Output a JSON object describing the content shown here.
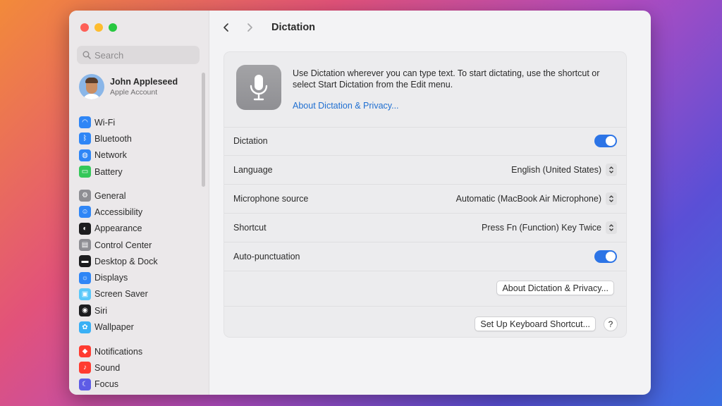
{
  "window": {
    "colors": {
      "accent": "#2c74e6",
      "link": "#1f6fd1",
      "sidebar": "#ebe8ea",
      "content": "#f3f3f5"
    }
  },
  "search": {
    "placeholder": "Search"
  },
  "account": {
    "name": "John Appleseed",
    "subtitle": "Apple Account"
  },
  "sidebar": {
    "groups": [
      [
        {
          "label": "Wi-Fi",
          "icon": "wifi-icon",
          "color": "#2f86f6"
        },
        {
          "label": "Bluetooth",
          "icon": "bluetooth-icon",
          "color": "#2f86f6"
        },
        {
          "label": "Network",
          "icon": "globe-icon",
          "color": "#2f86f6"
        },
        {
          "label": "Battery",
          "icon": "battery-icon",
          "color": "#34c759"
        }
      ],
      [
        {
          "label": "General",
          "icon": "gear-icon",
          "color": "#8e8e93"
        },
        {
          "label": "Accessibility",
          "icon": "accessibility-icon",
          "color": "#2f86f6"
        },
        {
          "label": "Appearance",
          "icon": "appearance-icon",
          "color": "#1c1c1e"
        },
        {
          "label": "Control Center",
          "icon": "control-center-icon",
          "color": "#8e8e93"
        },
        {
          "label": "Desktop & Dock",
          "icon": "dock-icon",
          "color": "#1c1c1e"
        },
        {
          "label": "Displays",
          "icon": "sun-icon",
          "color": "#2f86f6"
        },
        {
          "label": "Screen Saver",
          "icon": "screen-saver-icon",
          "color": "#5ac8fa"
        },
        {
          "label": "Siri",
          "icon": "siri-icon",
          "color": "#1c1c1e"
        },
        {
          "label": "Wallpaper",
          "icon": "flower-icon",
          "color": "#3ab0f5"
        }
      ],
      [
        {
          "label": "Notifications",
          "icon": "bell-icon",
          "color": "#ff3b30"
        },
        {
          "label": "Sound",
          "icon": "speaker-icon",
          "color": "#ff3b30"
        },
        {
          "label": "Focus",
          "icon": "moon-icon",
          "color": "#5e5ce6"
        }
      ]
    ]
  },
  "toolbar": {
    "title": "Dictation",
    "back_icon": "chevron-left-icon",
    "forward_icon": "chevron-right-icon"
  },
  "hero": {
    "icon": "microphone-icon",
    "description": "Use Dictation wherever you can type text. To start dictating, use the shortcut or select Start Dictation from the Edit menu.",
    "link": "About Dictation & Privacy..."
  },
  "settings": {
    "dictation": {
      "label": "Dictation",
      "enabled": true
    },
    "language": {
      "label": "Language",
      "value": "English (United States)"
    },
    "microphone": {
      "label": "Microphone source",
      "value": "Automatic (MacBook Air Microphone)"
    },
    "shortcut": {
      "label": "Shortcut",
      "value": "Press Fn (Function) Key Twice"
    },
    "autopunct": {
      "label": "Auto-punctuation",
      "enabled": true
    }
  },
  "buttons": {
    "about_privacy": "About Dictation & Privacy...",
    "keyboard_shortcut": "Set Up Keyboard Shortcut...",
    "help": "?"
  }
}
